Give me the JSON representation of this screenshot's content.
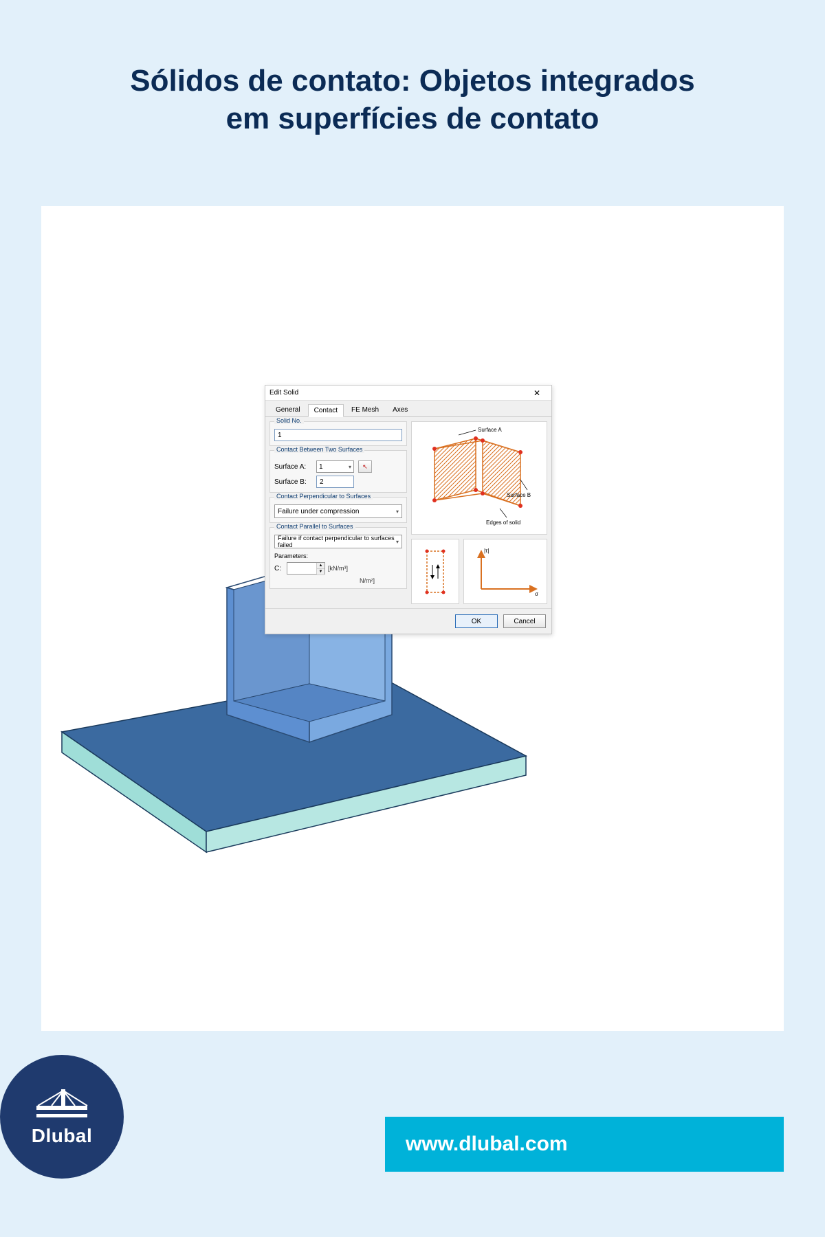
{
  "title_line1": "Sólidos de contato: Objetos integrados",
  "title_line2": "em superfícies de contato",
  "dialog": {
    "title": "Edit Solid",
    "close": "✕",
    "tabs": {
      "general": "General",
      "contact": "Contact",
      "femesh": "FE Mesh",
      "axes": "Axes"
    },
    "group_solid_no": "Solid No.",
    "solid_no_value": "1",
    "group_contact_between": "Contact Between Two Surfaces",
    "surface_a_label": "Surface A:",
    "surface_a_value": "1",
    "surface_b_label": "Surface B:",
    "surface_b_value": "2",
    "group_perpendicular": "Contact Perpendicular to Surfaces",
    "perpendicular_value": "Failure under compression",
    "group_parallel": "Contact Parallel to Surfaces",
    "parallel_value": "Failure if contact perpendicular to surfaces failed",
    "parameters_label": "Parameters:",
    "param_c_label": "C:",
    "param_c_unit": "[kN/m³]",
    "param2_unit": "N/m²]",
    "diagram": {
      "surface_a": "Surface A",
      "surface_b": "Surface B",
      "edges": "Edges of solid",
      "tau": "|τ|",
      "sigma": "σ"
    },
    "ok": "OK",
    "cancel": "Cancel"
  },
  "footer": {
    "url": "www.dlubal.com",
    "brand": "Dlubal"
  }
}
